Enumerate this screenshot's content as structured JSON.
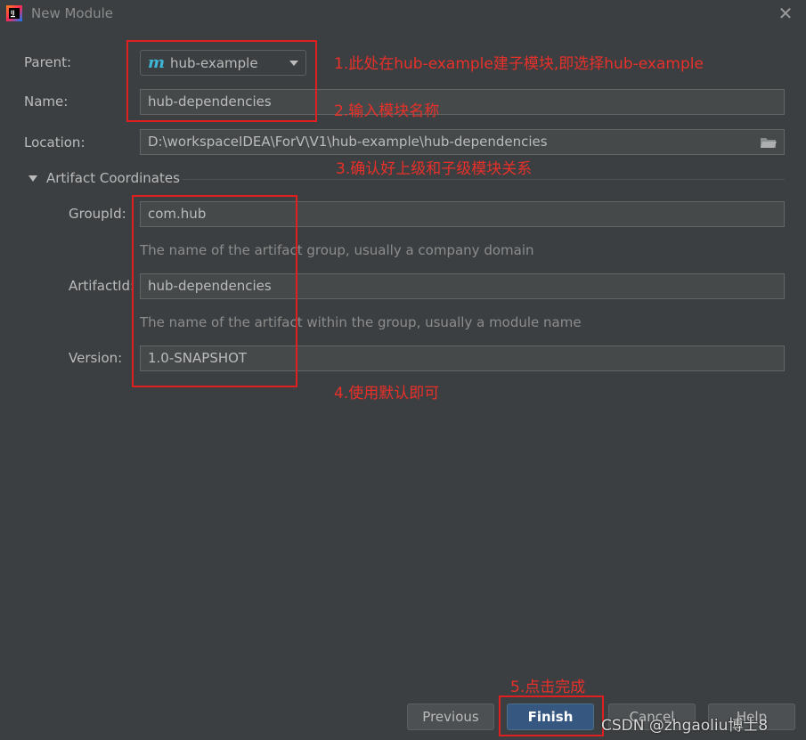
{
  "window": {
    "title": "New Module",
    "icon": "intellij-app-icon",
    "close_icon": "close-icon"
  },
  "form": {
    "parent": {
      "label": "Parent:",
      "value": "hub-example",
      "icon": "maven-module-icon"
    },
    "name": {
      "label": "Name:",
      "value": "hub-dependencies"
    },
    "location": {
      "label": "Location:",
      "value": "D:\\workspaceIDEA\\ForV\\V1\\hub-example\\hub-dependencies",
      "icon": "folder-browse-icon"
    }
  },
  "artifact": {
    "section_title": "Artifact Coordinates",
    "group_id": {
      "label": "GroupId:",
      "value": "com.hub",
      "hint": "The name of the artifact group, usually a company domain"
    },
    "artifact_id": {
      "label": "ArtifactId:",
      "value": "hub-dependencies",
      "hint": "The name of the artifact within the group, usually a module name"
    },
    "version": {
      "label": "Version:",
      "value": "1.0-SNAPSHOT"
    }
  },
  "annotations": {
    "a1": "1.此处在hub-example建子模块,即选择hub-example",
    "a2": "2.输入模块名称",
    "a3": "3.确认好上级和子级模块关系",
    "a4": "4.使用默认即可",
    "a5": "5.点击完成"
  },
  "buttons": {
    "previous": "Previous",
    "finish": "Finish",
    "cancel": "Cancel",
    "help": "Help"
  },
  "watermark": "CSDN @zhgaoliu博士8",
  "colors": {
    "background": "#3c3f41",
    "annotation_red": "#e8302a",
    "primary_button": "#365880",
    "maven_icon": "#3eb6d6"
  }
}
